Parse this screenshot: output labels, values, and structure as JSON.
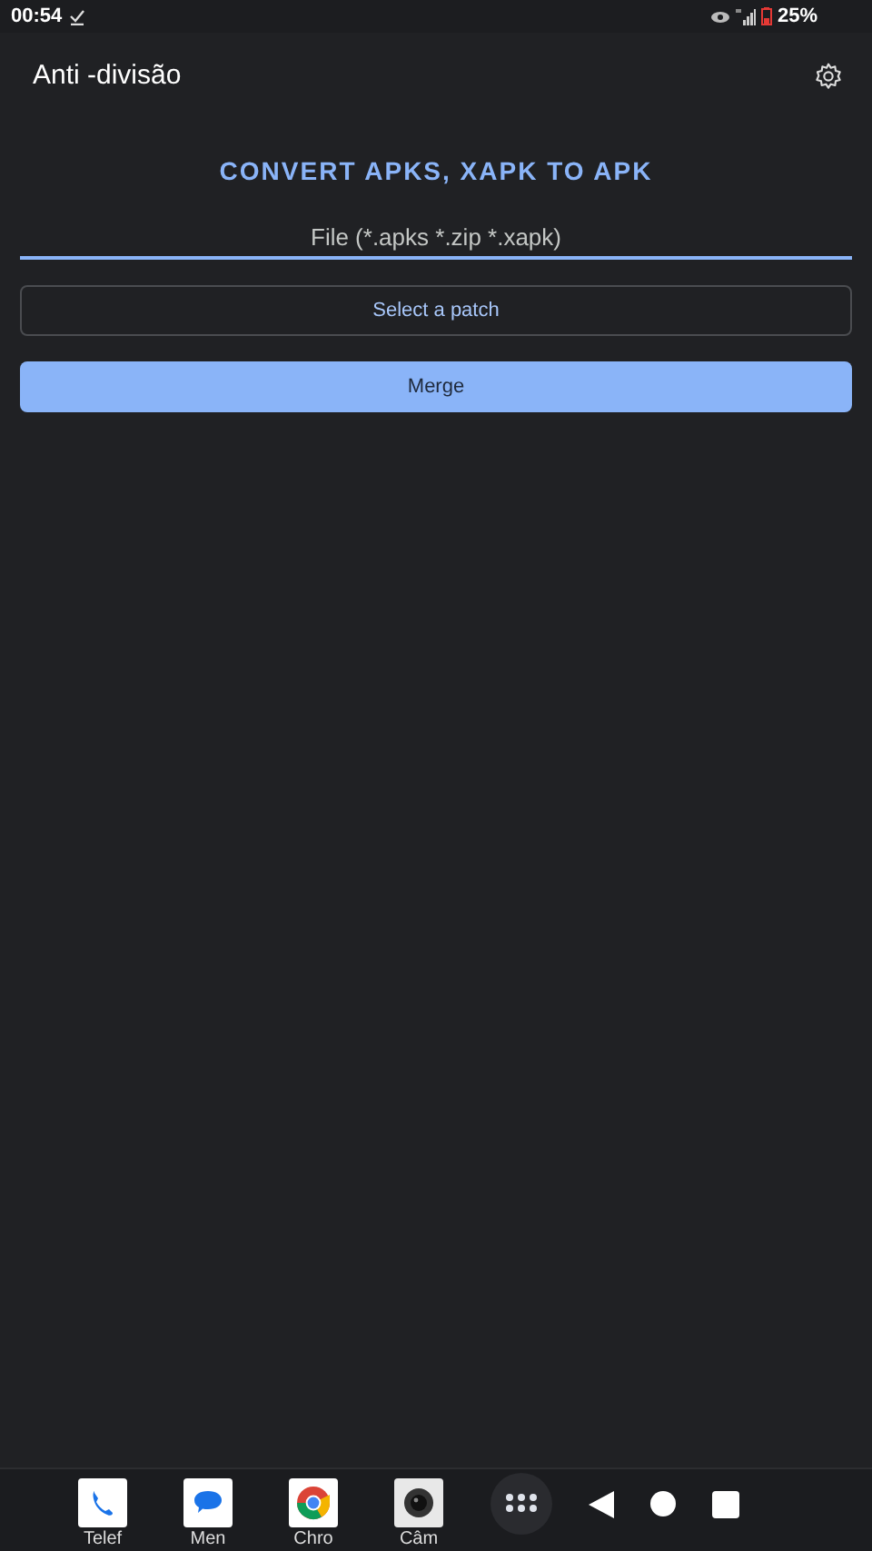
{
  "status_bar": {
    "time": "00:54",
    "battery": "25%"
  },
  "app_bar": {
    "title": "Anti -divisão"
  },
  "heading": "CONVERT APKS, XAPK TO APK",
  "file_field": {
    "placeholder": "File (*.apks *.zip *.xapk)"
  },
  "buttons": [
    {
      "label": "Select a patch",
      "kind": "outlined"
    },
    {
      "label": "Merge",
      "kind": "filled"
    }
  ],
  "taskbar": {
    "apps": [
      {
        "label": "Telef",
        "kind": "phone"
      },
      {
        "label": "Men",
        "kind": "messages"
      },
      {
        "label": "Chro",
        "kind": "browser"
      },
      {
        "label": "Câm",
        "kind": "camera"
      }
    ]
  }
}
